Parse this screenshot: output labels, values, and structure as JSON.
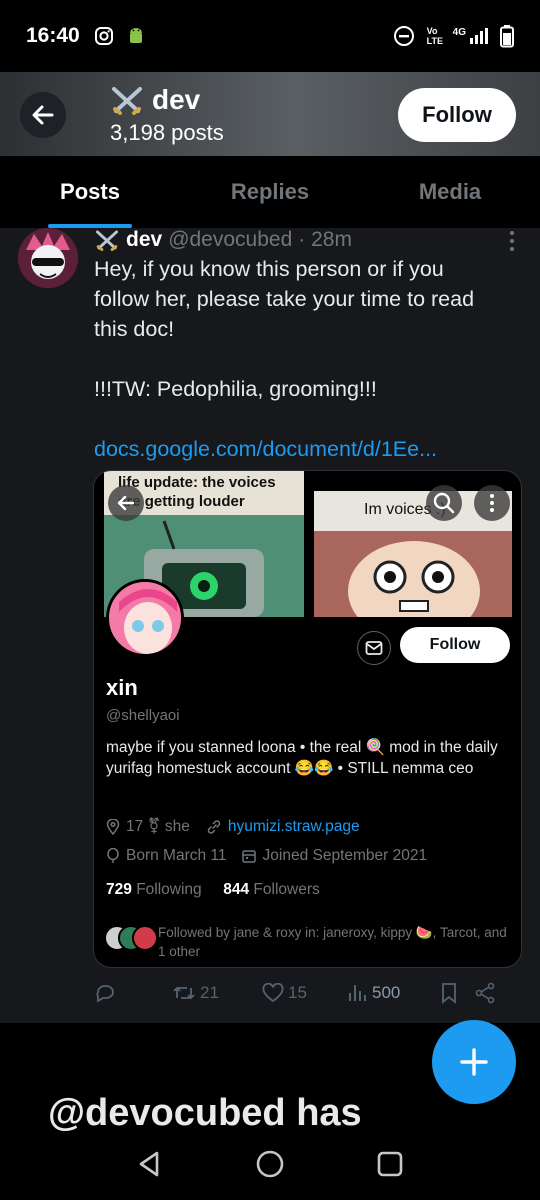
{
  "status_bar": {
    "time": "16:40",
    "network": "4G",
    "lte": "Vo LTE"
  },
  "header": {
    "title": "dev",
    "posts_count": "3,198 posts",
    "follow_label": "Follow"
  },
  "tabs": [
    {
      "label": "Posts",
      "active": true
    },
    {
      "label": "Replies",
      "active": false
    },
    {
      "label": "Media",
      "active": false
    }
  ],
  "tweet": {
    "name": "dev",
    "handle": "@devocubed",
    "time": "· 28m",
    "lines": [
      "Hey, if you know this person or if you",
      "follow her, please take your time to read",
      "this doc!",
      "",
      "!!!TW: Pedophilia, grooming!!!",
      ""
    ],
    "link": "docs.google.com/document/d/1Ee...",
    "card": {
      "banner_left_caption": "life update: the voices are getting louder",
      "banner_right_caption": "Im voices :)",
      "follow_label": "Follow",
      "name": "xin",
      "handle": "@shellyaoi",
      "bio": "maybe if you stanned loona • the real 🍭 mod in the daily yurifag homestuck account 😂😂 • STILL nemma ceo",
      "age_pronouns": "17 ⚧ she",
      "website": "hyumizi.straw.page",
      "born": "Born March 11",
      "joined": "Joined September 2021",
      "following_count": "729",
      "following_label": "Following",
      "followers_count": "844",
      "followers_label": "Followers",
      "followed_by": "Followed by jane & roxy in: janeroxy, kippy 🍉, Tarcot, and 1 other"
    },
    "actions": {
      "retweets": "21",
      "likes": "15",
      "views": "500"
    }
  },
  "bottom_banner": "@devocubed has",
  "colors": {
    "accent": "#1d9bf0",
    "background": "#000000",
    "feed": "#16181c"
  }
}
